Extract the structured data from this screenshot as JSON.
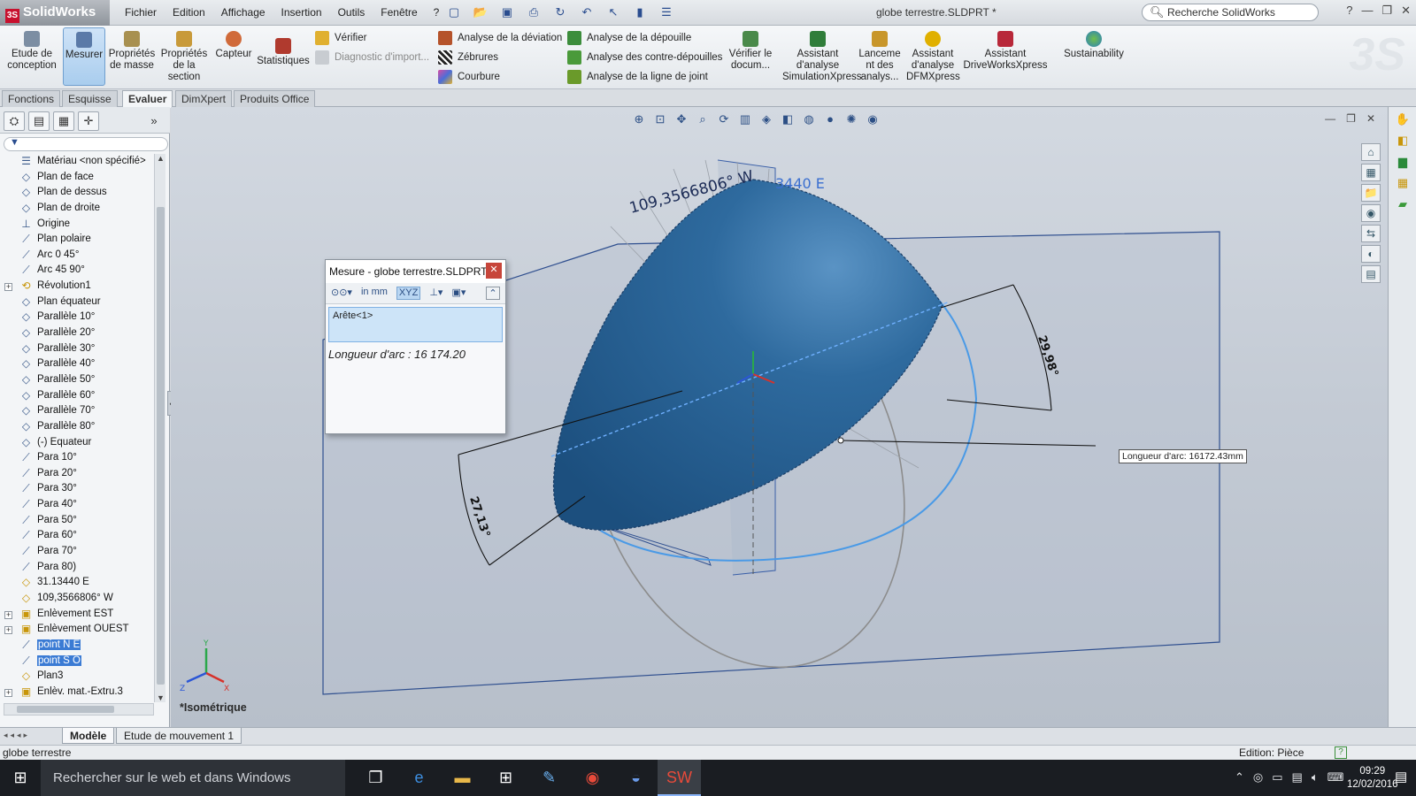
{
  "app": {
    "name": "SolidWorks",
    "document_title": "globe terrestre.SLDPRT *",
    "search_placeholder": "Recherche SolidWorks"
  },
  "menu": [
    "Fichier",
    "Edition",
    "Affichage",
    "Insertion",
    "Outils",
    "Fenêtre",
    "?"
  ],
  "ribbon": {
    "large_buttons": [
      {
        "label": "Etude de conception",
        "icon": "design-study-icon"
      },
      {
        "label": "Mesurer",
        "icon": "measure-icon",
        "active": true
      },
      {
        "label": "Propriétés de masse",
        "icon": "mass-properties-icon"
      },
      {
        "label": "Propriétés de la section",
        "icon": "section-properties-icon"
      },
      {
        "label": "Capteur",
        "icon": "sensor-icon"
      },
      {
        "label": "Statistiques",
        "icon": "statistics-icon"
      }
    ],
    "check_items": [
      {
        "label": "Vérifier",
        "enabled": true
      },
      {
        "label": "Diagnostic d'import...",
        "enabled": false
      }
    ],
    "analysis_items": [
      {
        "label": "Analyse de la déviation",
        "color": "#b5532b"
      },
      {
        "label": "Zébrures",
        "color": "#222222"
      },
      {
        "label": "Courbure",
        "color": "#d84ca3"
      }
    ],
    "draft_items": [
      {
        "label": "Analyse de la dépouille",
        "color": "#3c8d3c"
      },
      {
        "label": "Analyse des contre-dépouilles",
        "color": "#4a9a3a"
      },
      {
        "label": "Analyse de la ligne de joint",
        "color": "#6a9a2a"
      }
    ],
    "verify_doc": "Vérifier le docum...",
    "xpress": [
      "Assistant d'analyse SimulationXpress",
      "Lanceme nt des analys...",
      "Assistant d'analyse DFMXpress",
      "Assistant DriveWorksXpress",
      "Sustainability"
    ]
  },
  "command_tabs": [
    {
      "label": "Fonctions",
      "active": false
    },
    {
      "label": "Esquisse",
      "active": false
    },
    {
      "label": "Evaluer",
      "active": true
    },
    {
      "label": "DimXpert",
      "active": false
    },
    {
      "label": "Produits Office",
      "active": false
    }
  ],
  "tree": [
    {
      "label": "Matériau <non spécifié>",
      "icon": "material-icon",
      "expand": false,
      "selected": false
    },
    {
      "label": "Plan de face",
      "icon": "plane-icon",
      "expand": false,
      "selected": false
    },
    {
      "label": "Plan de dessus",
      "icon": "plane-icon",
      "expand": false,
      "selected": false
    },
    {
      "label": "Plan de droite",
      "icon": "plane-icon",
      "expand": false,
      "selected": false
    },
    {
      "label": "Origine",
      "icon": "origin-icon",
      "expand": false,
      "selected": false
    },
    {
      "label": "Plan polaire",
      "icon": "sketch-icon",
      "expand": false,
      "selected": false
    },
    {
      "label": "Arc 0 45°",
      "icon": "sketch-icon",
      "expand": false,
      "selected": false
    },
    {
      "label": "Arc 45 90°",
      "icon": "sketch-icon",
      "expand": false,
      "selected": false
    },
    {
      "label": "Révolution1",
      "icon": "revolve-icon",
      "expand": true,
      "selected": false
    },
    {
      "label": "Plan équateur",
      "icon": "plane-icon",
      "expand": false,
      "selected": false
    },
    {
      "label": "Parallèle 10°",
      "icon": "plane-icon",
      "expand": false,
      "selected": false
    },
    {
      "label": "Parallèle 20°",
      "icon": "plane-icon",
      "expand": false,
      "selected": false
    },
    {
      "label": "Parallèle 30°",
      "icon": "plane-icon",
      "expand": false,
      "selected": false
    },
    {
      "label": "Parallèle 40°",
      "icon": "plane-icon",
      "expand": false,
      "selected": false
    },
    {
      "label": "Parallèle 50°",
      "icon": "plane-icon",
      "expand": false,
      "selected": false
    },
    {
      "label": "Parallèle 60°",
      "icon": "plane-icon",
      "expand": false,
      "selected": false
    },
    {
      "label": "Parallèle 70°",
      "icon": "plane-icon",
      "expand": false,
      "selected": false
    },
    {
      "label": "Parallèle 80°",
      "icon": "plane-icon",
      "expand": false,
      "selected": false
    },
    {
      "label": "(-) Equateur",
      "icon": "plane-icon",
      "expand": false,
      "selected": false
    },
    {
      "label": "Para 10°",
      "icon": "sketch-icon",
      "expand": false,
      "selected": false
    },
    {
      "label": "Para 20°",
      "icon": "sketch-icon",
      "expand": false,
      "selected": false
    },
    {
      "label": "Para 30°",
      "icon": "sketch-icon",
      "expand": false,
      "selected": false
    },
    {
      "label": "Para 40°",
      "icon": "sketch-icon",
      "expand": false,
      "selected": false
    },
    {
      "label": "Para 50°",
      "icon": "sketch-icon",
      "expand": false,
      "selected": false
    },
    {
      "label": "Para 60°",
      "icon": "sketch-icon",
      "expand": false,
      "selected": false
    },
    {
      "label": "Para 70°",
      "icon": "sketch-icon",
      "expand": false,
      "selected": false
    },
    {
      "label": "Para 80)",
      "icon": "sketch-icon",
      "expand": false,
      "selected": false
    },
    {
      "label": "31.13440 E",
      "icon": "plane-yellow-icon",
      "expand": false,
      "selected": false
    },
    {
      "label": "109,3566806° W",
      "icon": "plane-yellow-icon",
      "expand": false,
      "selected": false
    },
    {
      "label": "Enlèvement EST",
      "icon": "cut-icon",
      "expand": true,
      "selected": false
    },
    {
      "label": "Enlèvement OUEST",
      "icon": "cut-icon",
      "expand": true,
      "selected": false
    },
    {
      "label": "point N E",
      "icon": "sketch-icon",
      "expand": false,
      "selected": true
    },
    {
      "label": "point S O",
      "icon": "sketch-icon",
      "expand": false,
      "selected": true
    },
    {
      "label": "Plan3",
      "icon": "plane-yellow-icon",
      "expand": false,
      "selected": false
    },
    {
      "label": "Enlèv. mat.-Extru.3",
      "icon": "extrude-cut-icon",
      "expand": true,
      "selected": false
    }
  ],
  "measure_dialog": {
    "title": "Mesure - globe terrestre.SLDPRT",
    "selection": "Arête<1>",
    "result": "Longueur d'arc : 16 174.20",
    "units_icon": "in mm"
  },
  "viewport": {
    "view_name": "*Isométrique",
    "labels": {
      "longitude_w": "109,3566806° W",
      "longitude_e": "3440 E",
      "angle1": "29,98°",
      "angle2": "27,13°",
      "callout": "Longueur d'arc: 16172.43mm"
    }
  },
  "model_tabs": [
    {
      "label": "Modèle",
      "active": true
    },
    {
      "label": "Etude de mouvement 1",
      "active": false
    }
  ],
  "statusbar": {
    "left": "globe terrestre",
    "edit": "Edition: Pièce"
  },
  "taskbar": {
    "search": "Rechercher sur le web et dans Windows",
    "time": "09:29",
    "date": "12/02/2016"
  }
}
